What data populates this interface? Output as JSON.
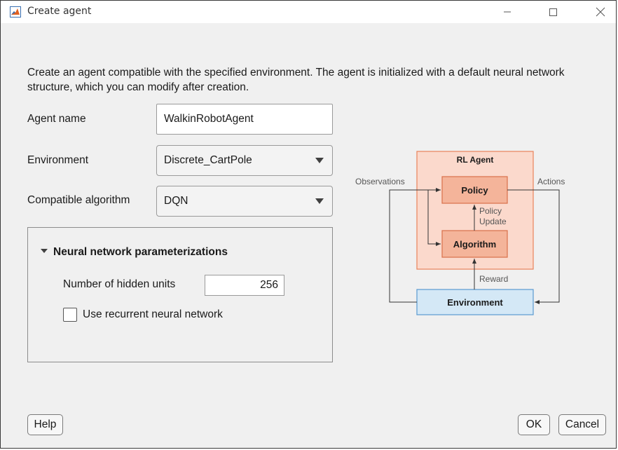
{
  "window": {
    "title": "Create agent",
    "icon": "matlab-icon"
  },
  "description": "Create an agent compatible with the specified environment. The agent is initialized with a default neural network structure, which you can modify after creation.",
  "form": {
    "agent_name_label": "Agent name",
    "agent_name_value": "WalkinRobotAgent",
    "environment_label": "Environment",
    "environment_value": "Discrete_CartPole",
    "algorithm_label": "Compatible algorithm",
    "algorithm_value": "DQN"
  },
  "nn_panel": {
    "header": "Neural network parameterizations",
    "hidden_units_label": "Number of hidden units",
    "hidden_units_value": "256",
    "recurrent_label": "Use recurrent neural network",
    "recurrent_checked": false
  },
  "diagram": {
    "agent_title": "RL Agent",
    "policy": "Policy",
    "algorithm": "Algorithm",
    "environment": "Environment",
    "observations": "Observations",
    "actions": "Actions",
    "policy_update_1": "Policy",
    "policy_update_2": "Update",
    "reward": "Reward",
    "colors": {
      "agent_fill": "#fbd9cc",
      "agent_border": "#e8835a",
      "block_fill": "#f4b49a",
      "block_border": "#d9704a",
      "env_fill": "#d4e8f6",
      "env_border": "#5a9ad0"
    }
  },
  "buttons": {
    "help": "Help",
    "ok": "OK",
    "cancel": "Cancel"
  }
}
